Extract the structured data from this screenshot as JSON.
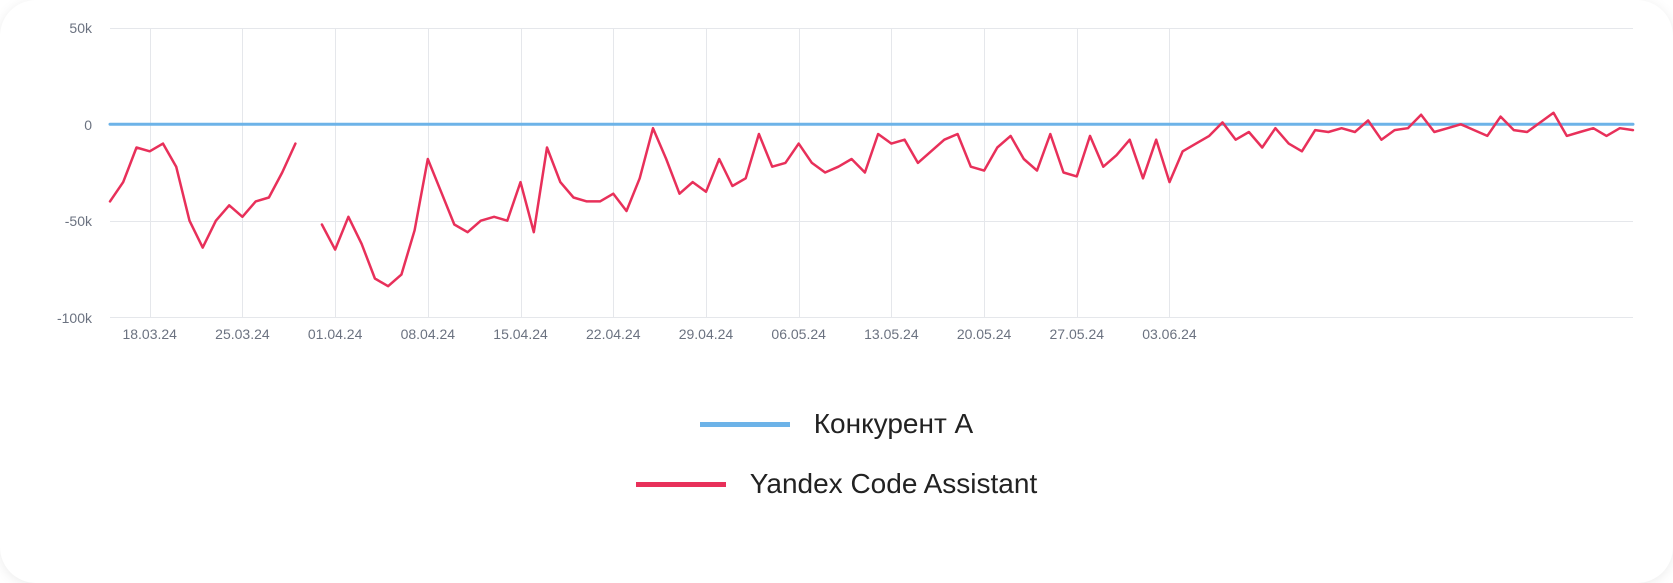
{
  "chart_data": {
    "type": "line",
    "ylabel": "",
    "xlabel": "",
    "ylim": [
      -100000,
      50000
    ],
    "y_ticks": [
      "50k",
      "0",
      "-50k",
      "-100k"
    ],
    "x_ticks": [
      "18.03.24",
      "25.03.24",
      "01.04.24",
      "08.04.24",
      "15.04.24",
      "22.04.24",
      "29.04.24",
      "06.05.24",
      "13.05.24",
      "20.05.24",
      "27.05.24",
      "03.06.24"
    ],
    "series": [
      {
        "name": "Конкурент A",
        "color": "#6db3e8",
        "values": [
          0,
          0,
          0,
          0,
          0,
          0,
          0,
          0,
          0,
          0,
          0,
          0,
          0,
          0,
          0,
          0,
          0,
          0,
          0,
          0,
          0,
          0,
          0,
          0,
          0,
          0,
          0,
          0,
          0,
          0,
          0,
          0,
          0,
          0,
          0,
          0,
          0,
          0,
          0,
          0,
          0,
          0,
          0,
          0,
          0,
          0,
          0,
          0,
          0,
          0,
          0,
          0,
          0,
          0,
          0,
          0,
          0,
          0,
          0,
          0,
          0,
          0,
          0,
          0,
          0,
          0,
          0,
          0,
          0,
          0,
          0,
          0,
          0,
          0,
          0,
          0,
          0,
          0,
          0,
          0,
          0,
          0,
          0,
          0,
          0,
          0,
          0,
          0,
          0,
          0,
          0
        ]
      },
      {
        "name": "Yandex Code Assistant",
        "color": "#e8305a",
        "values": [
          -40000,
          -30000,
          -12000,
          -14000,
          -10000,
          -22000,
          -50000,
          -64000,
          -50000,
          -42000,
          -48000,
          -40000,
          -38000,
          -25000,
          -10000,
          null,
          -52000,
          -65000,
          -48000,
          -62000,
          -80000,
          -84000,
          -78000,
          -55000,
          -18000,
          -35000,
          -52000,
          -56000,
          -50000,
          -48000,
          -50000,
          -30000,
          -56000,
          -12000,
          -30000,
          -38000,
          -40000,
          -40000,
          -36000,
          -45000,
          -28000,
          -2000,
          -18000,
          -36000,
          -30000,
          -35000,
          -18000,
          -32000,
          -28000,
          -5000,
          -22000,
          -20000,
          -10000,
          -20000,
          -25000,
          -22000,
          -18000,
          -25000,
          -5000,
          -10000,
          -8000,
          -20000,
          -14000,
          -8000,
          -5000,
          -22000,
          -24000,
          -12000,
          -6000,
          -18000,
          -24000,
          -5000,
          -25000,
          -27000,
          -6000,
          -22000,
          -16000,
          -8000,
          -28000,
          -8000,
          -30000,
          -14000,
          -10000,
          -6000,
          1000,
          -8000,
          -4000,
          -12000,
          -2000,
          -10000,
          -14000,
          -3000,
          -4000,
          -2000,
          -4000,
          2000,
          -8000,
          -3000,
          -2000,
          5000,
          -4000,
          -2000,
          0,
          -3000,
          -6000,
          4000,
          -3000,
          -4000,
          1000,
          6000,
          -6000,
          -4000,
          -2000,
          -6000,
          -2000,
          -3000
        ]
      }
    ]
  },
  "legend": {
    "items": [
      {
        "label": "Конкурент A",
        "color": "#6db3e8"
      },
      {
        "label": "Yandex Code Assistant",
        "color": "#e8305a"
      }
    ]
  }
}
